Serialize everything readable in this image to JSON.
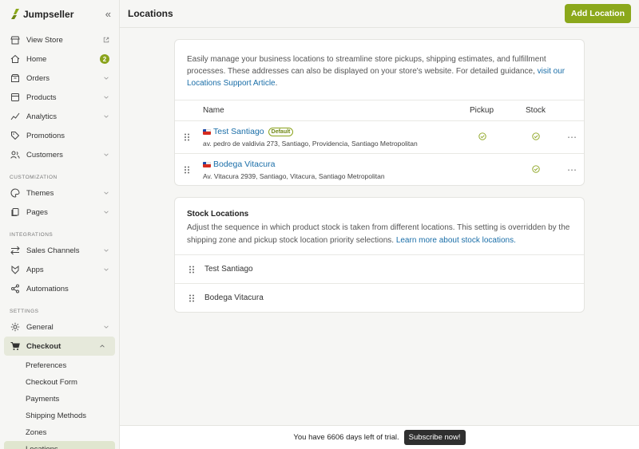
{
  "brand": {
    "name": "Jumpseller"
  },
  "sidebar": {
    "top_items": [
      {
        "label": "View Store",
        "icon": "store-icon"
      },
      {
        "label": "Home",
        "icon": "home-icon",
        "badge": "2"
      },
      {
        "label": "Orders",
        "icon": "orders-icon"
      },
      {
        "label": "Products",
        "icon": "products-icon"
      },
      {
        "label": "Analytics",
        "icon": "analytics-icon"
      },
      {
        "label": "Promotions",
        "icon": "tag-icon"
      },
      {
        "label": "Customers",
        "icon": "customers-icon"
      }
    ],
    "customization_label": "CUSTOMIZATION",
    "customization_items": [
      {
        "label": "Themes",
        "icon": "palette-icon"
      },
      {
        "label": "Pages",
        "icon": "pages-icon"
      }
    ],
    "integrations_label": "INTEGRATIONS",
    "integrations_items": [
      {
        "label": "Sales Channels",
        "icon": "channels-icon"
      },
      {
        "label": "Apps",
        "icon": "apps-icon"
      },
      {
        "label": "Automations",
        "icon": "automations-icon"
      }
    ],
    "settings_label": "SETTINGS",
    "settings_items": [
      {
        "label": "General",
        "icon": "gear-icon"
      },
      {
        "label": "Checkout",
        "icon": "cart-icon"
      }
    ],
    "checkout_sub": [
      "Preferences",
      "Checkout Form",
      "Payments",
      "Shipping Methods",
      "Zones",
      "Locations"
    ]
  },
  "header": {
    "title": "Locations",
    "add_button": "Add Location"
  },
  "locations_card": {
    "intro_text": "Easily manage your business locations to streamline store pickups, shipping estimates, and fulfillment processes. These addresses can also be displayed on your store's website. For detailed guidance, ",
    "intro_link": "visit our Locations Support Article",
    "intro_end": ".",
    "columns": {
      "name": "Name",
      "pickup": "Pickup",
      "stock": "Stock"
    },
    "rows": [
      {
        "name": "Test Santiago",
        "badge": "Default",
        "address": "av. pedro de valdivia 273, Santiago, Providencia, Santiago Metropolitan",
        "pickup": true,
        "stock": true
      },
      {
        "name": "Bodega Vitacura",
        "address": "Av. Vitacura 2939, Santiago, Vitacura, Santiago Metropolitan",
        "pickup": false,
        "stock": true
      }
    ],
    "more_icon": "⋯"
  },
  "stock_card": {
    "title": "Stock Locations",
    "desc": "Adjust the sequence in which product stock is taken from different locations. This setting is overridden by the shipping zone and pickup stock location priority selections. ",
    "desc_link": "Learn more about stock locations.",
    "items": [
      "Test Santiago",
      "Bodega Vitacura"
    ]
  },
  "trial": {
    "text": "You have 6606 days left of trial.",
    "button": "Subscribe now!"
  },
  "colors": {
    "accent": "#8ba81b",
    "link": "#1a6ea8"
  }
}
